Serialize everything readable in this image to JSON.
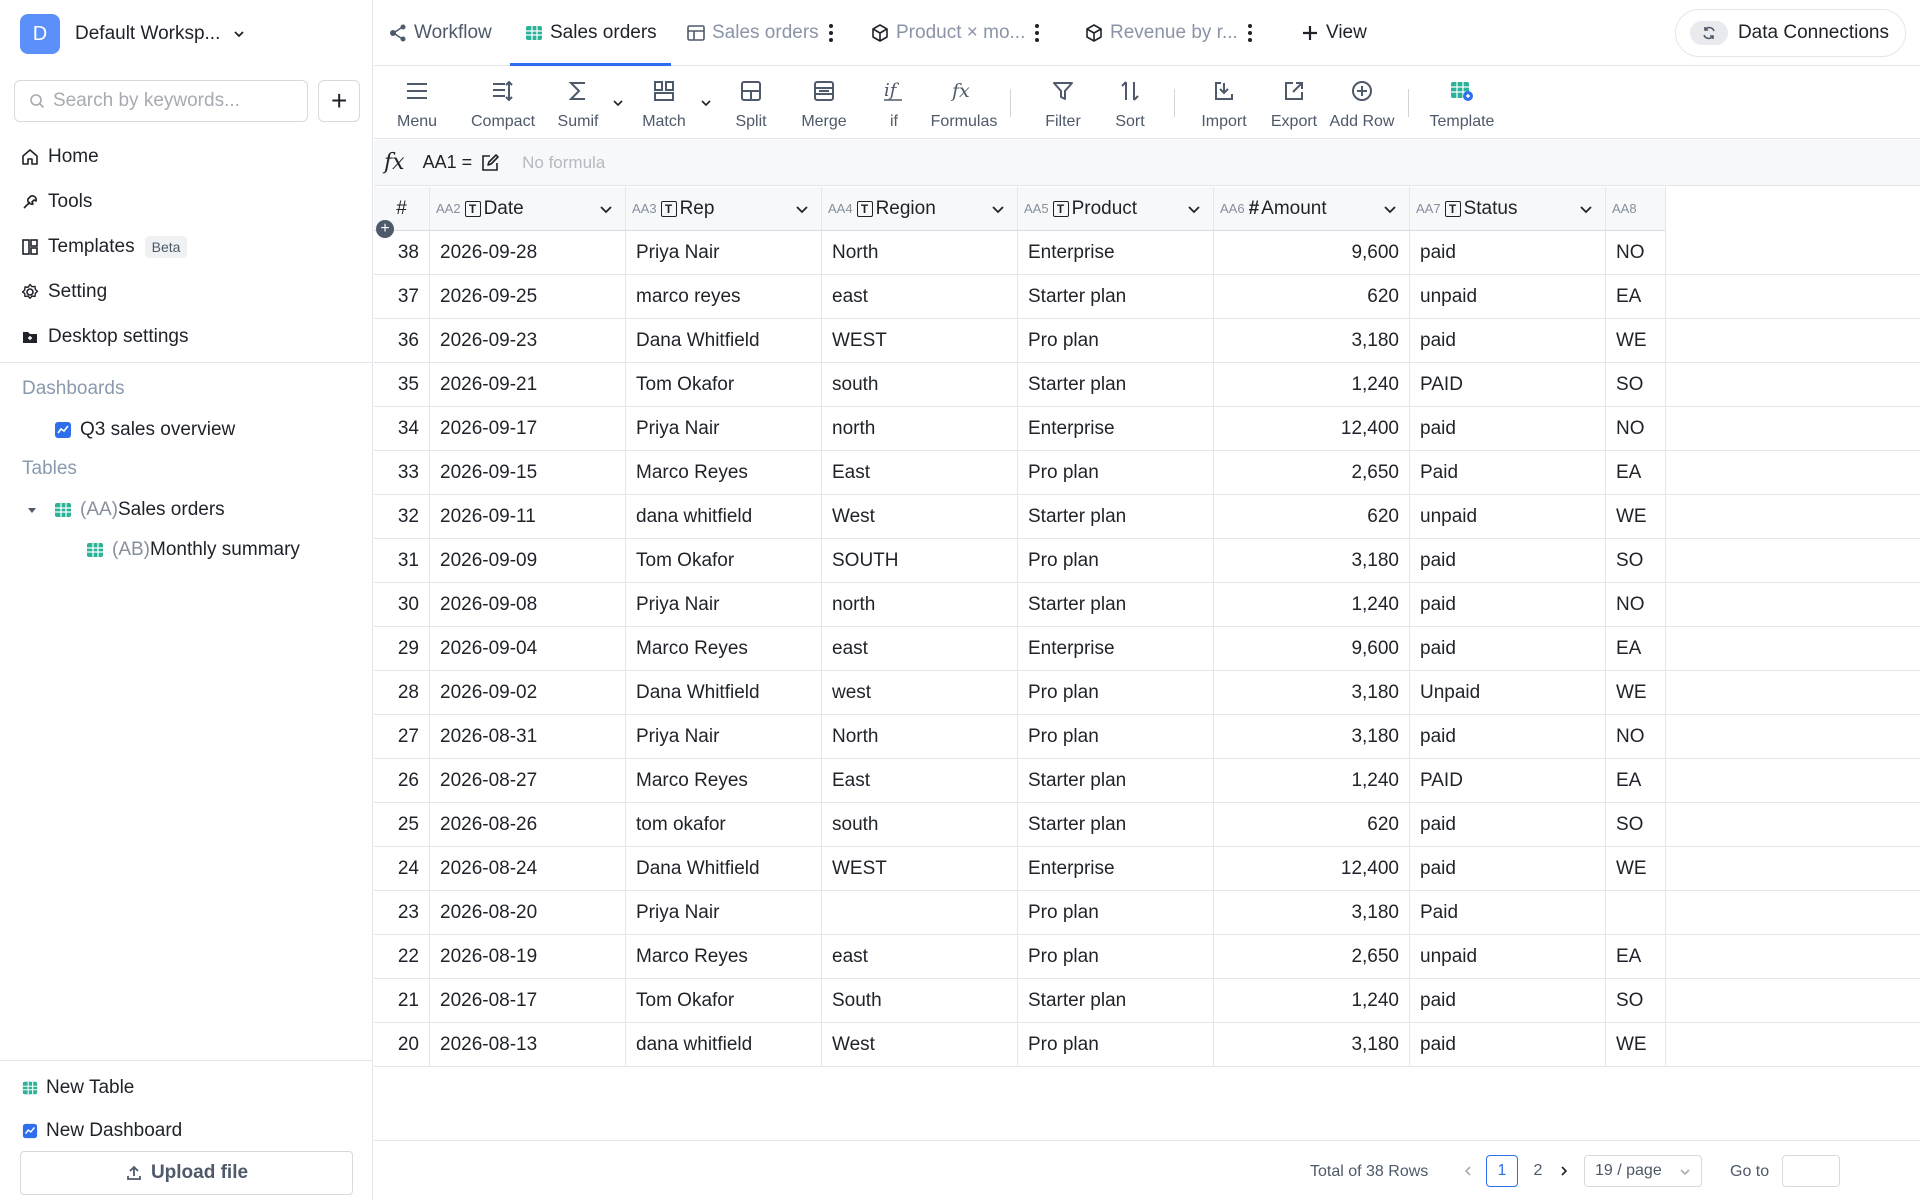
{
  "workspace": {
    "avatar": "D",
    "name": "Default Worksp..."
  },
  "search": {
    "placeholder": "Search by keywords...",
    "value": ""
  },
  "nav": [
    {
      "label": "Home",
      "icon": "home-icon"
    },
    {
      "label": "Tools",
      "icon": "wrench-icon"
    },
    {
      "label": "Templates",
      "icon": "templates-icon",
      "badge": "Beta"
    },
    {
      "label": "Setting",
      "icon": "gear-icon"
    },
    {
      "label": "Desktop settings",
      "icon": "desktop-settings-icon"
    }
  ],
  "dashboards": {
    "title": "Dashboards",
    "items": [
      {
        "label": "Q3 sales overview"
      }
    ]
  },
  "tables": {
    "title": "Tables",
    "items": [
      {
        "prefix": "(AA)",
        "label": "Sales orders"
      },
      {
        "prefix": "(AB)",
        "label": "Monthly summary"
      }
    ]
  },
  "bottom": {
    "new_table": "New Table",
    "new_dashboard": "New Dashboard",
    "upload": "Upload file"
  },
  "tabs": [
    {
      "label": "Workflow",
      "icon": "workflow-icon",
      "state": "normal"
    },
    {
      "label": "Sales orders",
      "icon": "sheet-icon",
      "state": "active"
    },
    {
      "label": "Sales orders",
      "icon": "table-icon",
      "state": "muted"
    },
    {
      "label": "Product × mo...",
      "icon": "cube-icon",
      "state": "muted"
    },
    {
      "label": "Revenue by r...",
      "icon": "cube-icon",
      "state": "muted"
    }
  ],
  "add_view": "View",
  "data_connections": "Data Connections",
  "toolbar": [
    {
      "label": "Menu",
      "icon": "menu-icon"
    },
    {
      "label": "Compact",
      "icon": "compact-icon"
    },
    {
      "label": "Sumif",
      "icon": "sigma-icon"
    },
    {
      "label": "Match",
      "icon": "match-icon"
    },
    {
      "label": "Split",
      "icon": "split-icon"
    },
    {
      "label": "Merge",
      "icon": "merge-icon"
    },
    {
      "label": "if",
      "icon": "if-icon"
    },
    {
      "label": "Formulas",
      "icon": "fx-icon"
    },
    {
      "label": "Filter",
      "icon": "filter-icon"
    },
    {
      "label": "Sort",
      "icon": "sort-icon"
    },
    {
      "label": "Import",
      "icon": "import-icon"
    },
    {
      "label": "Export",
      "icon": "export-icon"
    },
    {
      "label": "Add Row",
      "icon": "add-row-icon"
    },
    {
      "label": "Template",
      "icon": "template-icon"
    }
  ],
  "formula": {
    "fx": "fx",
    "cell": "AA1 =",
    "placeholder": "No formula"
  },
  "columns": [
    {
      "id": "",
      "label": "#",
      "type": ""
    },
    {
      "id": "AA2",
      "label": "Date",
      "type": "text"
    },
    {
      "id": "AA3",
      "label": "Rep",
      "type": "text"
    },
    {
      "id": "AA4",
      "label": "Region",
      "type": "text"
    },
    {
      "id": "AA5",
      "label": "Product",
      "type": "text"
    },
    {
      "id": "AA6",
      "label": "Amount",
      "type": "number"
    },
    {
      "id": "AA7",
      "label": "Status",
      "type": "text"
    },
    {
      "id": "AA8",
      "label": "",
      "type": ""
    }
  ],
  "rows": [
    [
      "38",
      "2026-09-28",
      "Priya Nair",
      "North",
      "Enterprise",
      "9,600",
      "paid",
      "NO"
    ],
    [
      "37",
      "2026-09-25",
      "marco reyes",
      "east",
      "Starter plan",
      "620",
      "unpaid",
      "EA"
    ],
    [
      "36",
      "2026-09-23",
      "Dana Whitfield",
      "WEST",
      "Pro plan",
      "3,180",
      "paid",
      "WE"
    ],
    [
      "35",
      "2026-09-21",
      "Tom Okafor",
      "south",
      "Starter plan",
      "1,240",
      "PAID",
      "SO"
    ],
    [
      "34",
      "2026-09-17",
      "Priya Nair",
      "north",
      "Enterprise",
      "12,400",
      "paid",
      "NO"
    ],
    [
      "33",
      "2026-09-15",
      "Marco Reyes",
      "East",
      "Pro plan",
      "2,650",
      "Paid",
      "EA"
    ],
    [
      "32",
      "2026-09-11",
      "dana whitfield",
      "West",
      "Starter plan",
      "620",
      "unpaid",
      "WE"
    ],
    [
      "31",
      "2026-09-09",
      "Tom Okafor",
      "SOUTH",
      "Pro plan",
      "3,180",
      "paid",
      "SO"
    ],
    [
      "30",
      "2026-09-08",
      "Priya Nair",
      "north",
      "Starter plan",
      "1,240",
      "paid",
      "NO"
    ],
    [
      "29",
      "2026-09-04",
      "Marco Reyes",
      "east",
      "Enterprise",
      "9,600",
      "paid",
      "EA"
    ],
    [
      "28",
      "2026-09-02",
      "Dana Whitfield",
      "west",
      "Pro plan",
      "3,180",
      "Unpaid",
      "WE"
    ],
    [
      "27",
      "2026-08-31",
      "Priya Nair",
      "North",
      "Pro plan",
      "3,180",
      "paid",
      "NO"
    ],
    [
      "26",
      "2026-08-27",
      "Marco Reyes",
      "East",
      "Starter plan",
      "1,240",
      "PAID",
      "EA"
    ],
    [
      "25",
      "2026-08-26",
      "tom okafor",
      "south",
      "Starter plan",
      "620",
      "paid",
      "SO"
    ],
    [
      "24",
      "2026-08-24",
      "Dana Whitfield",
      "WEST",
      "Enterprise",
      "12,400",
      "paid",
      "WE"
    ],
    [
      "23",
      "2026-08-20",
      "Priya Nair",
      "",
      "Pro plan",
      "3,180",
      "Paid",
      ""
    ],
    [
      "22",
      "2026-08-19",
      "Marco Reyes",
      "east",
      "Pro plan",
      "2,650",
      "unpaid",
      "EA"
    ],
    [
      "21",
      "2026-08-17",
      "Tom Okafor",
      "South",
      "Starter plan",
      "1,240",
      "paid",
      "SO"
    ],
    [
      "20",
      "2026-08-13",
      "dana whitfield",
      "West",
      "Pro plan",
      "3,180",
      "paid",
      "WE"
    ]
  ],
  "pagination": {
    "total": "Total of 38 Rows",
    "pages": [
      "1",
      "2"
    ],
    "current": "1",
    "page_size": "19 / page",
    "goto": "Go to"
  },
  "colors": {
    "accent": "#2f6fed",
    "avatar": "#5b8ff9",
    "table_icon": "#2bb39a",
    "dashboard_icon": "#2f6fed"
  }
}
